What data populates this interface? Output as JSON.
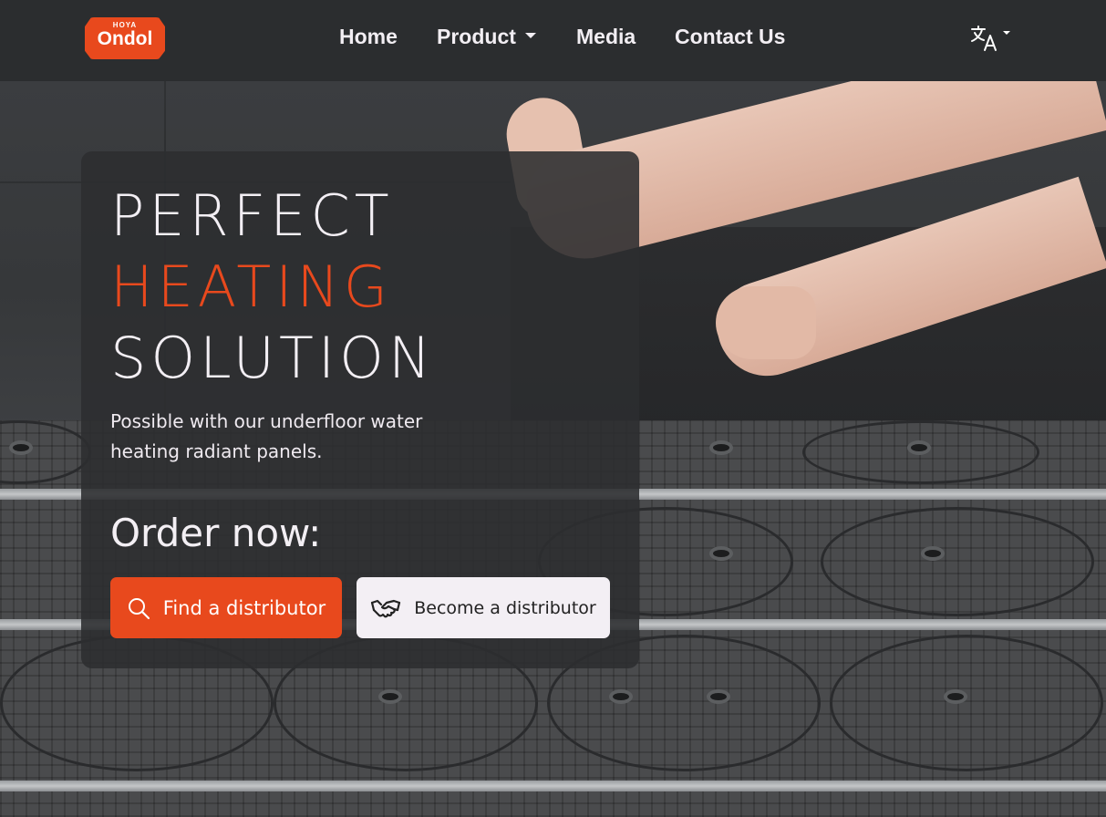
{
  "brand": {
    "logo_small": "HOYA",
    "logo_big": "Ondol",
    "accent_color": "#e8491d"
  },
  "nav": {
    "items": [
      {
        "label": "Home"
      },
      {
        "label": "Product",
        "has_dropdown": true
      },
      {
        "label": "Media"
      },
      {
        "label": "Contact Us"
      }
    ],
    "language_icon": "translate-icon"
  },
  "hero": {
    "headline_line1": "PERFECT",
    "headline_line2": "HEATING",
    "headline_line3": "SOLUTION",
    "subtitle": "Possible with our underfloor water heating radiant panels.",
    "order_label": "Order now:",
    "find_button": {
      "label": "Find a distributor",
      "icon": "search-icon"
    },
    "become_button": {
      "label": "Become a distributor",
      "icon": "handshake-icon"
    }
  }
}
